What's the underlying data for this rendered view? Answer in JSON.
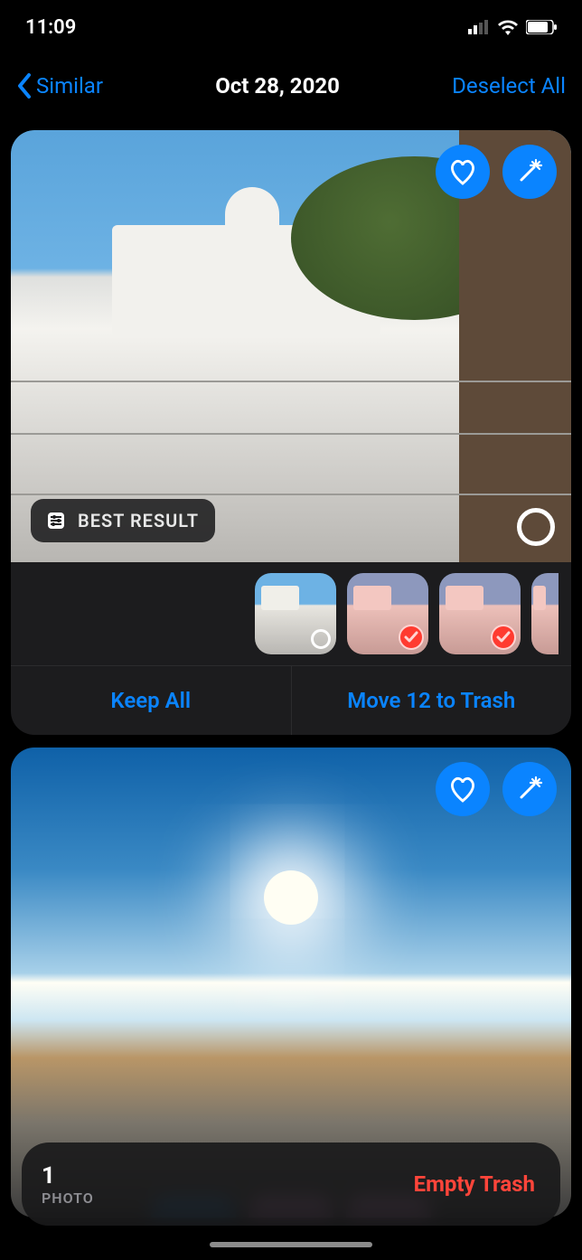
{
  "status": {
    "time": "11:09"
  },
  "nav": {
    "back_label": "Similar",
    "title": "Oct 28, 2020",
    "deselect_label": "Deselect All"
  },
  "card1": {
    "best_label": "BEST RESULT",
    "keep_label": "Keep All",
    "move_label": "Move 12 to Trash",
    "thumbs": [
      {
        "selected": false
      },
      {
        "selected": true
      },
      {
        "selected": true
      },
      {
        "selected": true
      }
    ]
  },
  "trash": {
    "count": "1",
    "unit": "PHOTO",
    "empty_label": "Empty Trash"
  }
}
